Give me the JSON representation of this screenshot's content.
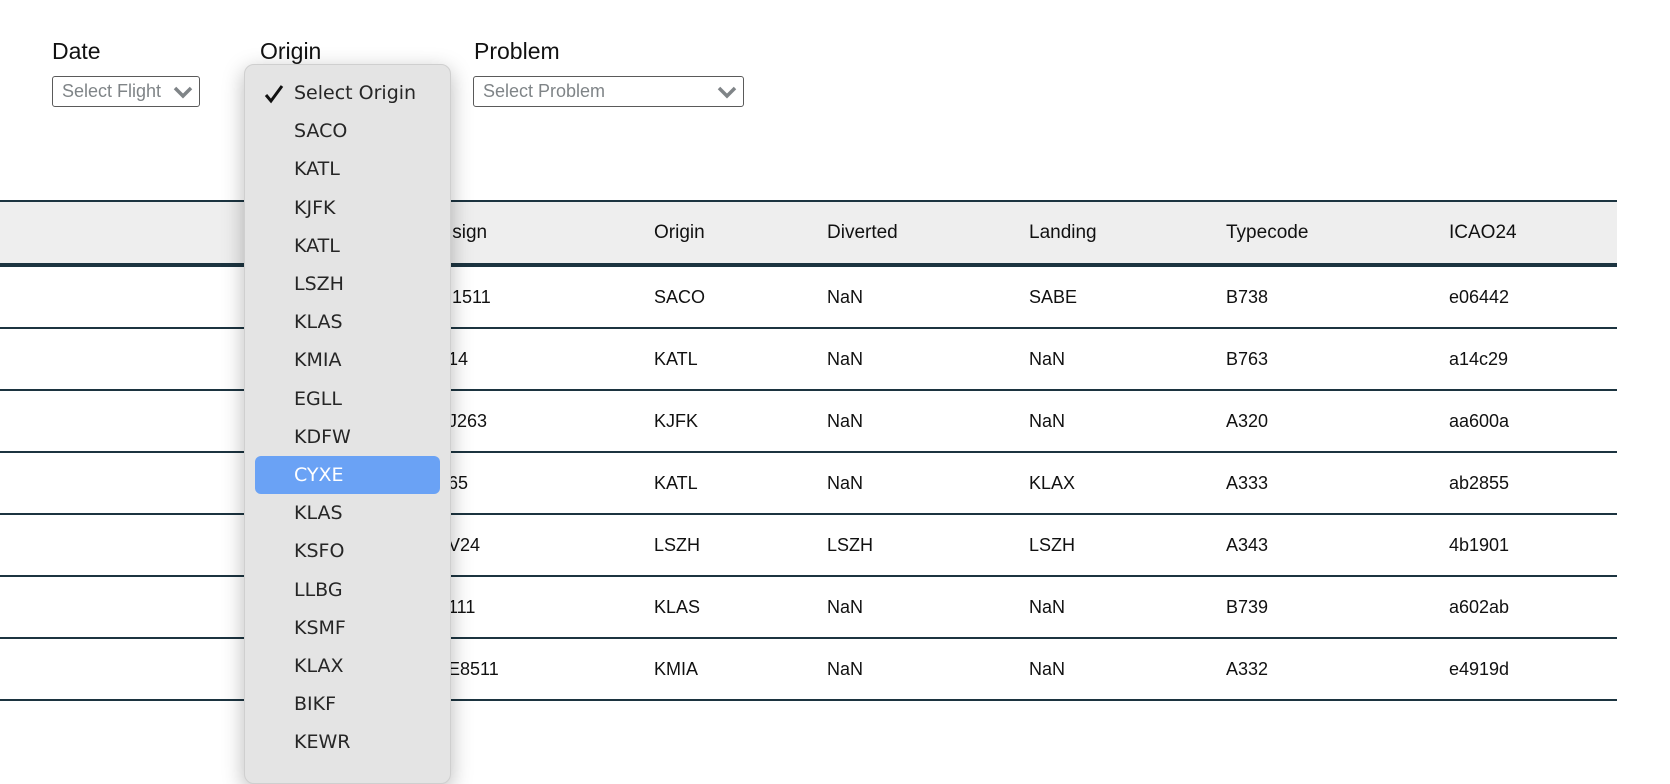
{
  "filters": {
    "date": {
      "label": "Date",
      "placeholder": "Select Flight"
    },
    "origin": {
      "label": "Origin"
    },
    "problem": {
      "label": "Problem",
      "placeholder": "Select Problem"
    }
  },
  "origin_dropdown": {
    "selected": "Select Origin",
    "highlighted": "CYXE",
    "options": [
      "Select Origin",
      "SACO",
      "KATL",
      "KJFK",
      "KATL",
      "LSZH",
      "KLAS",
      "KMIA",
      "EGLL",
      "KDFW",
      "CYXE",
      "KLAS",
      "KSFO",
      "LLBG",
      "KSMF",
      "KLAX",
      "BIKF",
      "KEWR"
    ]
  },
  "table": {
    "headers": [
      "lsign",
      "Origin",
      "Diverted",
      "Landing",
      "Typecode",
      "ICAO24"
    ],
    "rows": [
      [
        "i1511",
        "SACO",
        "NaN",
        "SABE",
        "B738",
        "e06442"
      ],
      [
        "14",
        "KATL",
        "NaN",
        "NaN",
        "B763",
        "a14c29"
      ],
      [
        "J263",
        "KJFK",
        "NaN",
        "NaN",
        "A320",
        "aa600a"
      ],
      [
        "65",
        "KATL",
        "NaN",
        "KLAX",
        "A333",
        "ab2855"
      ],
      [
        "V24",
        "LSZH",
        "LSZH",
        "LSZH",
        "A343",
        "4b1901"
      ],
      [
        "111",
        "KLAS",
        "NaN",
        "NaN",
        "B739",
        "a602ab"
      ],
      [
        "E8511",
        "KMIA",
        "NaN",
        "NaN",
        "A332",
        "e4919d"
      ]
    ]
  },
  "colors": {
    "highlight": "#6aa2f5",
    "table_border": "#1c3440",
    "header_bg": "#eeeeee"
  },
  "icons": {
    "select_chevron": "chevron-down-icon",
    "selected_mark": "checkmark-icon"
  }
}
